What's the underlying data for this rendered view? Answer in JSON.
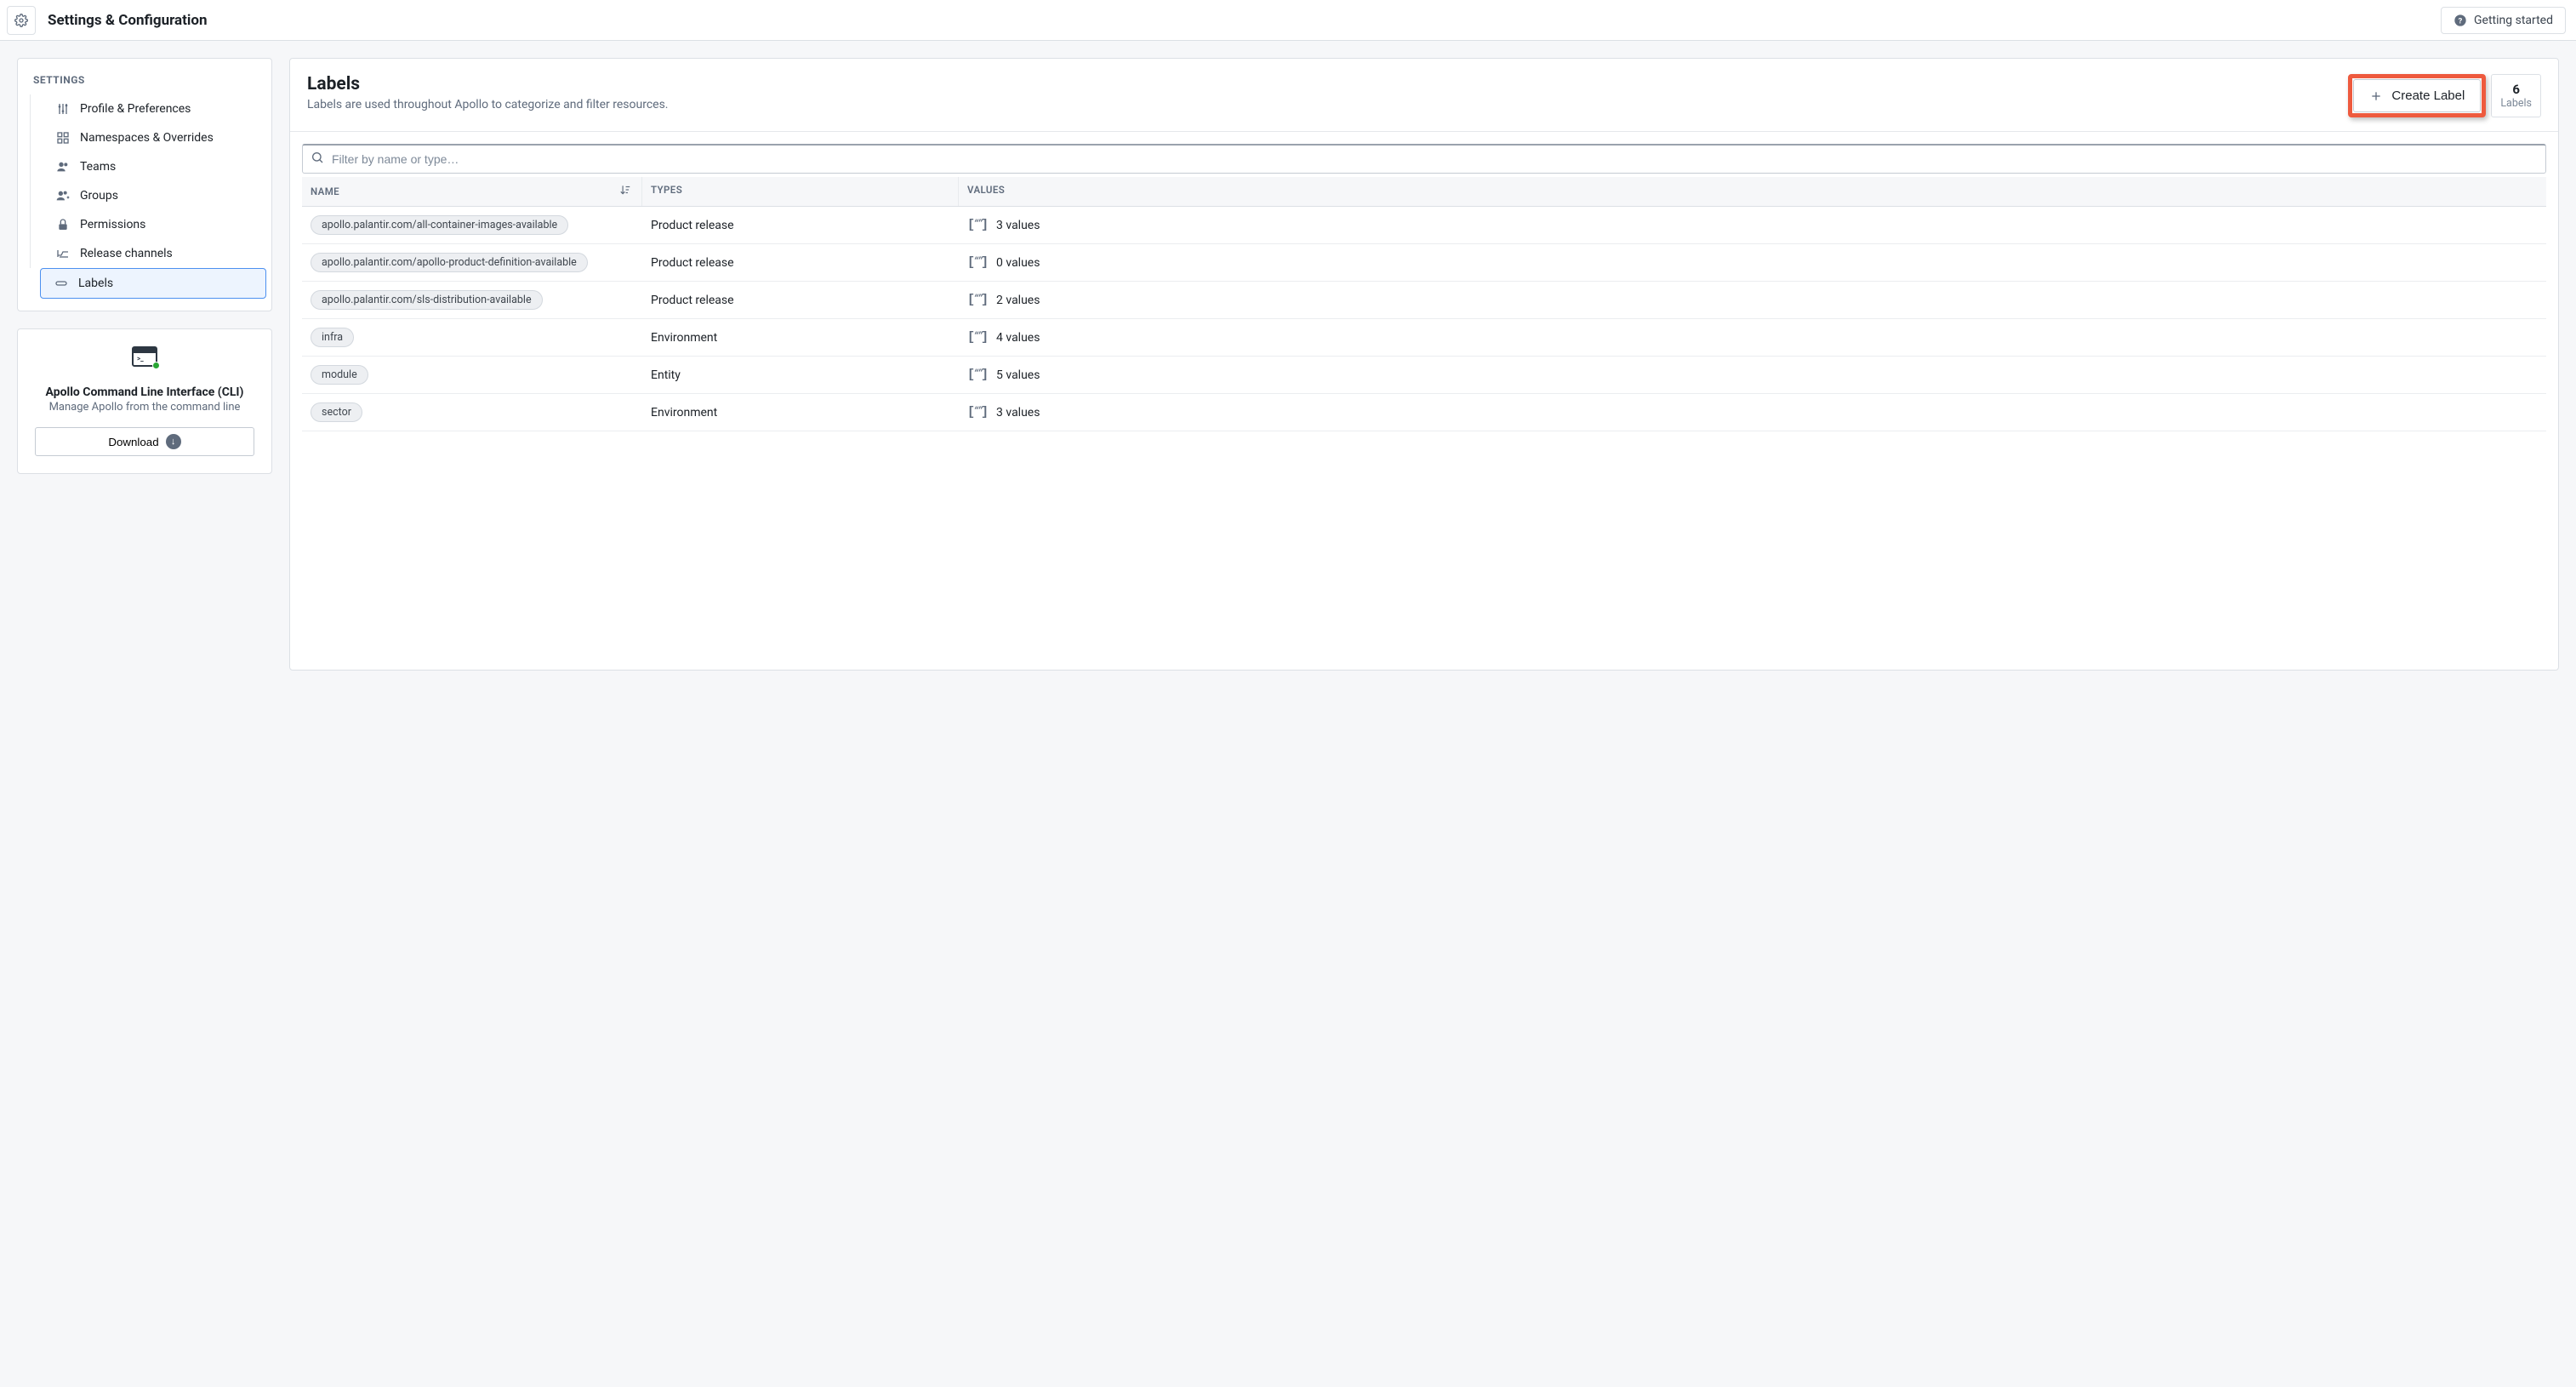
{
  "header": {
    "title": "Settings & Configuration",
    "getting_started": "Getting started"
  },
  "sidebar": {
    "heading": "SETTINGS",
    "items": [
      {
        "label": "Profile & Preferences",
        "icon": "sliders"
      },
      {
        "label": "Namespaces & Overrides",
        "icon": "namespaces"
      },
      {
        "label": "Teams",
        "icon": "people"
      },
      {
        "label": "Groups",
        "icon": "people-plus"
      },
      {
        "label": "Permissions",
        "icon": "lock"
      },
      {
        "label": "Release channels",
        "icon": "release"
      },
      {
        "label": "Labels",
        "icon": "label",
        "active": true
      }
    ]
  },
  "cli": {
    "title": "Apollo Command Line Interface (CLI)",
    "sub": "Manage Apollo from the command line",
    "download": "Download"
  },
  "main": {
    "title": "Labels",
    "sub": "Labels are used throughout Apollo to categorize and filter resources.",
    "create_label": "Create Label",
    "count": "6",
    "count_label": "Labels",
    "filter_placeholder": "Filter by name or type…",
    "columns": {
      "name": "NAME",
      "types": "TYPES",
      "values": "VALUES"
    },
    "rows": [
      {
        "name": "apollo.palantir.com/all-container-images-available",
        "type": "Product release",
        "values": "3 values"
      },
      {
        "name": "apollo.palantir.com/apollo-product-definition-available",
        "type": "Product release",
        "values": "0 values"
      },
      {
        "name": "apollo.palantir.com/sls-distribution-available",
        "type": "Product release",
        "values": "2 values"
      },
      {
        "name": "infra",
        "type": "Environment",
        "values": "4 values"
      },
      {
        "name": "module",
        "type": "Entity",
        "values": "5 values"
      },
      {
        "name": "sector",
        "type": "Environment",
        "values": "3 values"
      }
    ]
  }
}
